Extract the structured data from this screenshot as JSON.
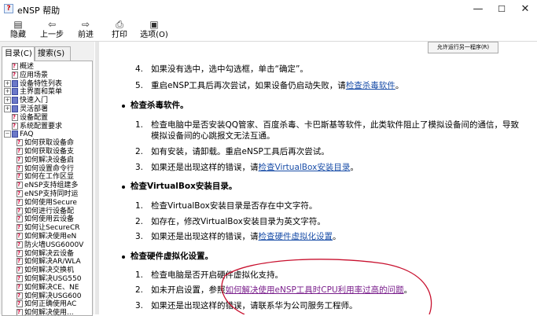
{
  "window": {
    "title": "eNSP 帮助",
    "icon": "help-app-icon",
    "minimize": "—",
    "maximize": "☐",
    "close": "✕"
  },
  "toolbar": {
    "hide": "隐藏",
    "back": "上一步",
    "forward": "前进",
    "print": "打印",
    "options": "选项(O)"
  },
  "left_panel": {
    "tabs": [
      "目录(C)",
      "搜索(S)"
    ],
    "tree": [
      {
        "label": "概述",
        "icon": "page"
      },
      {
        "label": "应用场景",
        "icon": "page"
      },
      {
        "label": "设备特性列表",
        "icon": "book",
        "toggle": "+"
      },
      {
        "label": "主界面和菜单",
        "icon": "book",
        "toggle": "+"
      },
      {
        "label": "快速入门",
        "icon": "book",
        "toggle": "+"
      },
      {
        "label": "灵活部署",
        "icon": "book",
        "toggle": "+"
      },
      {
        "label": "设备配置",
        "icon": "page"
      },
      {
        "label": "系统配置要求",
        "icon": "page"
      },
      {
        "label": "FAQ",
        "icon": "book-open",
        "toggle": "−"
      },
      {
        "label": "如何获取设备命",
        "icon": "page"
      },
      {
        "label": "如何获取设备支",
        "icon": "page"
      },
      {
        "label": "如何解决设备启",
        "icon": "page"
      },
      {
        "label": "如何设置命令行",
        "icon": "page"
      },
      {
        "label": "如何在工作区显",
        "icon": "page"
      },
      {
        "label": "eNSP支持组建多",
        "icon": "page"
      },
      {
        "label": "eNSP支持同时运",
        "icon": "page"
      },
      {
        "label": "如何使用Secure",
        "icon": "page"
      },
      {
        "label": "如何进行设备配",
        "icon": "page"
      },
      {
        "label": "如何使用云设备",
        "icon": "page"
      },
      {
        "label": "如何让SecureCR",
        "icon": "page"
      },
      {
        "label": "如何解决使用eN",
        "icon": "page"
      },
      {
        "label": "防火墙USG6000V",
        "icon": "page"
      },
      {
        "label": "如何解决云设备",
        "icon": "page"
      },
      {
        "label": "如何解决AR/WLA",
        "icon": "page"
      },
      {
        "label": "如何解决交换机",
        "icon": "page"
      },
      {
        "label": "如何解决USG550",
        "icon": "page"
      },
      {
        "label": "如何解决CE、NE",
        "icon": "page"
      },
      {
        "label": "如何解决USG600",
        "icon": "page"
      },
      {
        "label": "如何正确使用AC",
        "icon": "page"
      },
      {
        "label": "如何解决使用...",
        "icon": "page"
      }
    ]
  },
  "content": {
    "nav_button": "允许运行另一程序(R)",
    "steps_top": [
      {
        "num": "4.",
        "text": "如果没有选中，选中勾选框，单击“确定”。"
      },
      {
        "num": "5.",
        "text": "重启eNSP工具后再次尝试，如果设备仍启动失败，请",
        "link": "检查杀毒软件",
        "suffix": "。"
      }
    ],
    "sections": [
      {
        "heading": "检查杀毒软件。",
        "steps": [
          {
            "num": "1.",
            "text": "检查电脑中是否安装QQ管家、百度杀毒、卡巴斯基等软件，此类软件阻止了模拟设备间的通信，导致"
          },
          {
            "num": "",
            "text": "模拟设备间的心跳报文无法互通。"
          },
          {
            "num": "2.",
            "text": "如有安装，请卸载。重启eNSP工具后再次尝试。"
          },
          {
            "num": "3.",
            "text": "如果还是出现这样的错误，请",
            "link": "检查VirtualBox安装目录",
            "suffix": "。"
          }
        ]
      },
      {
        "heading": "检查VirtualBox安装目录。",
        "steps": [
          {
            "num": "1.",
            "text": "检查VirtualBox安装目录是否存在中文字符。"
          },
          {
            "num": "2.",
            "text": "如存在，修改VirtualBox安装目录为英文字符。"
          },
          {
            "num": "3.",
            "text": "如果还是出现这样的错误，请",
            "link": "检查硬件虚拟化设置",
            "suffix": "。"
          }
        ]
      },
      {
        "heading": "检查硬件虚拟化设置。",
        "steps": [
          {
            "num": "1.",
            "text": "检查电脑是否开启硬件虚拟化支持。"
          },
          {
            "num": "2.",
            "text": "如未开启设置，参照",
            "link": "如何解决使用eNSP工具时CPU利用率过高的问题",
            "suffix": "。"
          },
          {
            "num": "3.",
            "text": "如果还是出现这样的错误，请联系华为公司服务工程师。"
          }
        ]
      }
    ],
    "annotation_color": "#c8102e"
  }
}
